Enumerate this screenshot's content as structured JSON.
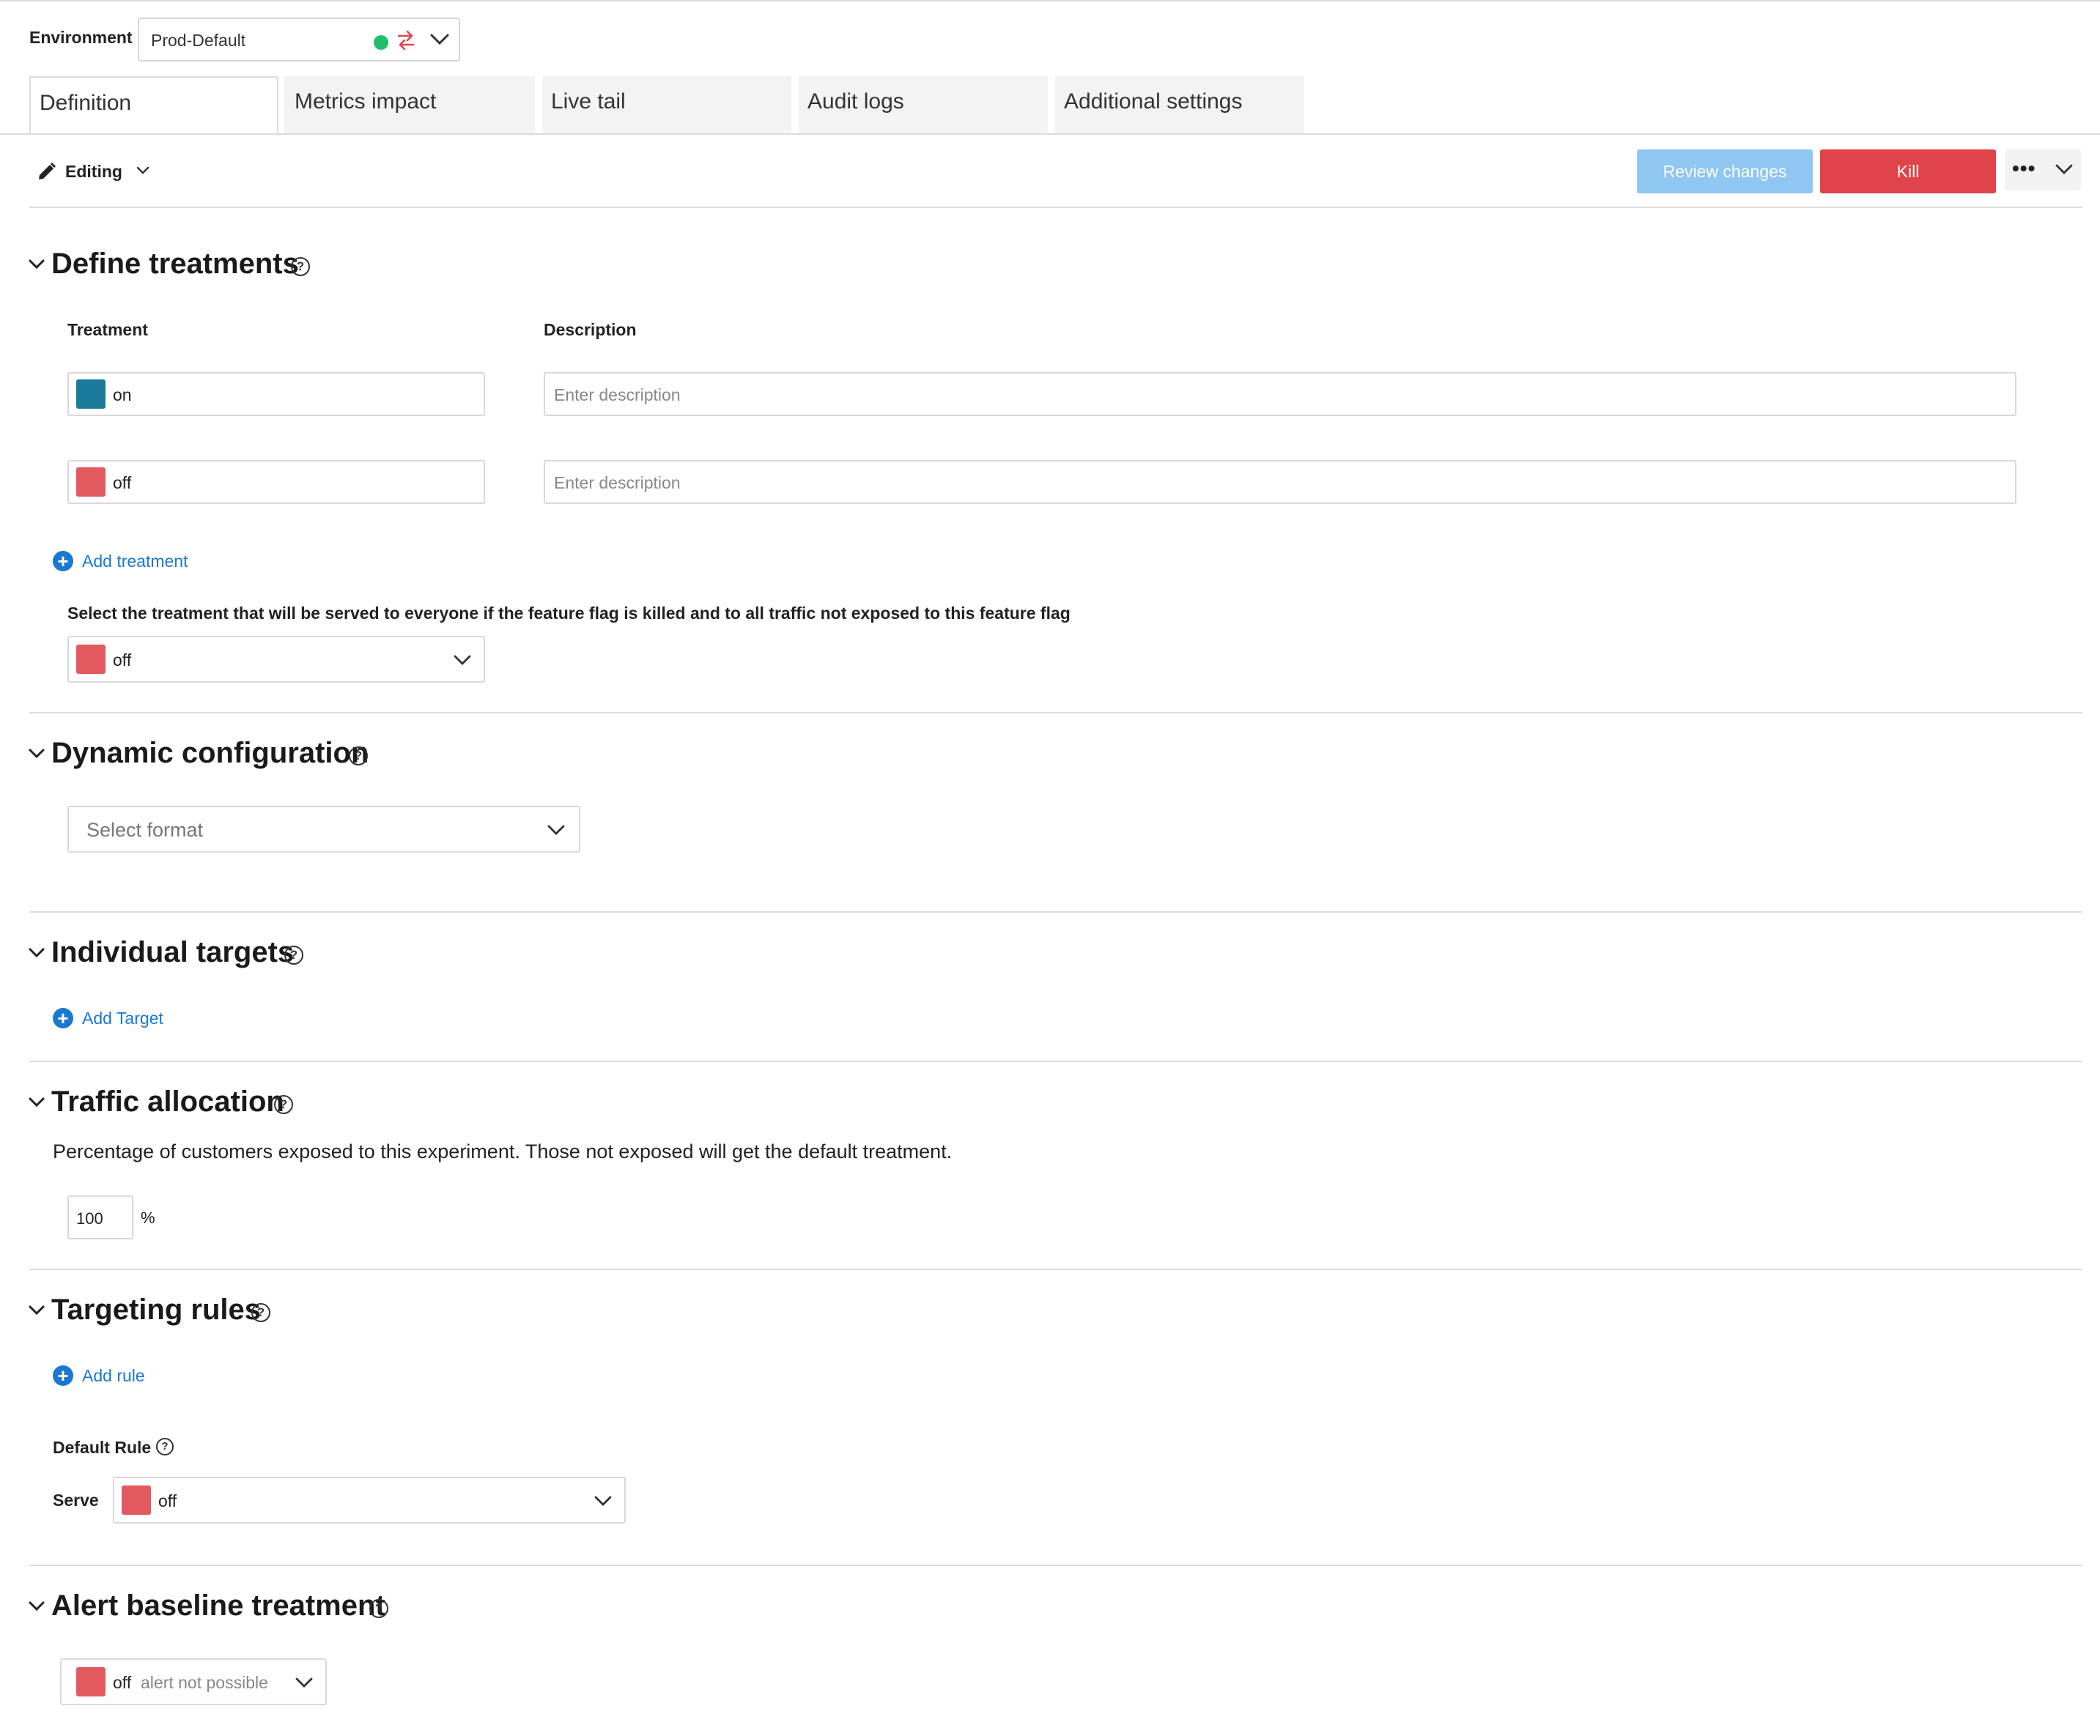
{
  "environment": {
    "label": "Environment",
    "value": "Prod-Default",
    "status_color": "#1fbf6b",
    "swap_icon_color": "#e0444a"
  },
  "tabs": [
    {
      "label": "Definition",
      "active": true
    },
    {
      "label": "Metrics impact",
      "active": false
    },
    {
      "label": "Live tail",
      "active": false
    },
    {
      "label": "Audit logs",
      "active": false
    },
    {
      "label": "Additional settings",
      "active": false
    }
  ],
  "toolbar": {
    "mode_label": "Editing",
    "review_label": "Review changes",
    "kill_label": "Kill",
    "more_label": "•••"
  },
  "define_treatments": {
    "title": "Define treatments",
    "treatment_col": "Treatment",
    "description_col": "Description",
    "rows": [
      {
        "name": "on",
        "color": "#1b7a99",
        "description_placeholder": "Enter description"
      },
      {
        "name": "off",
        "color": "#e05a5f",
        "description_placeholder": "Enter description"
      }
    ],
    "add_label": "Add treatment",
    "default_prompt": "Select the treatment that will be served to everyone if the feature flag is killed and to all traffic not exposed to this feature flag",
    "default_value": "off",
    "default_color": "#e05a5f"
  },
  "dynamic_configuration": {
    "title": "Dynamic configuration",
    "format_placeholder": "Select format"
  },
  "individual_targets": {
    "title": "Individual targets",
    "add_label": "Add Target"
  },
  "traffic_allocation": {
    "title": "Traffic allocation",
    "description": "Percentage of customers exposed to this experiment. Those not exposed will get the default treatment.",
    "value": "100",
    "unit": "%"
  },
  "targeting_rules": {
    "title": "Targeting rules",
    "add_label": "Add rule",
    "default_rule_label": "Default Rule",
    "serve_label": "Serve",
    "serve_value": "off",
    "serve_color": "#e05a5f"
  },
  "alert_baseline": {
    "title": "Alert baseline treatment",
    "value": "off",
    "note": "alert not possible",
    "color": "#e05a5f"
  },
  "help_glyph": "?"
}
